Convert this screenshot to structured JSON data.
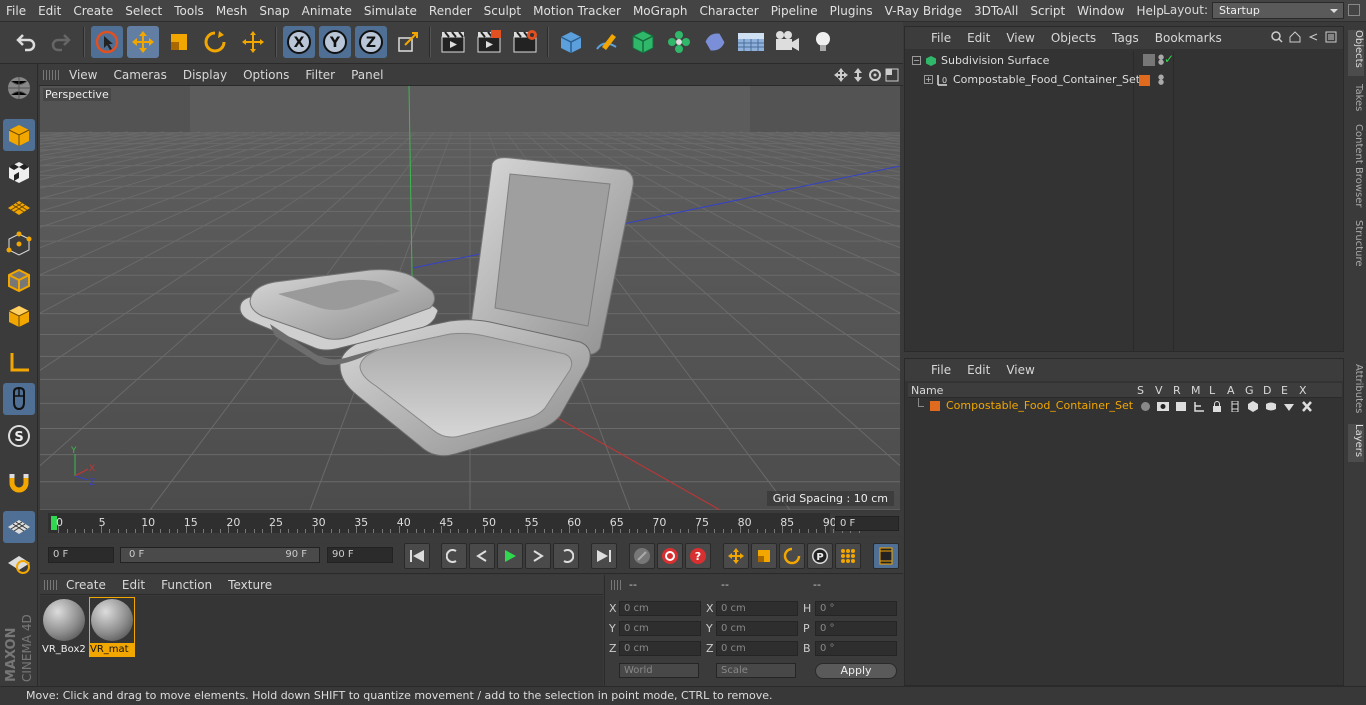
{
  "menu": [
    "File",
    "Edit",
    "Create",
    "Select",
    "Tools",
    "Mesh",
    "Snap",
    "Animate",
    "Simulate",
    "Render",
    "Sculpt",
    "Motion Tracker",
    "MoGraph",
    "Character",
    "Pipeline",
    "Plugins",
    "V-Ray Bridge",
    "3DToAll",
    "Script",
    "Window",
    "Help"
  ],
  "layout": {
    "label": "Layout:",
    "value": "Startup"
  },
  "viewport": {
    "menu": [
      "View",
      "Cameras",
      "Display",
      "Options",
      "Filter",
      "Panel"
    ],
    "camera": "Perspective",
    "grid_spacing": "Grid Spacing : 10 cm"
  },
  "axes": {
    "y": "Y",
    "x": "X",
    "z": "Z"
  },
  "timeline": {
    "ticks": [
      "0",
      "5",
      "10",
      "15",
      "20",
      "25",
      "30",
      "35",
      "40",
      "45",
      "50",
      "55",
      "60",
      "65",
      "70",
      "75",
      "80",
      "85",
      "90"
    ],
    "current": "0 F",
    "start": "0 F",
    "range_start": "0 F",
    "range_end": "90 F",
    "end": "90 F"
  },
  "materials": {
    "menu": [
      "Create",
      "Edit",
      "Function",
      "Texture"
    ],
    "items": [
      {
        "name": "VR_Box2"
      },
      {
        "name": "VR_mat"
      }
    ]
  },
  "coords": {
    "headers": [
      "--",
      "--",
      "--"
    ],
    "rows": [
      {
        "a": "X",
        "av": "0 cm",
        "b": "X",
        "bv": "0 cm",
        "c": "H",
        "cv": "0 °"
      },
      {
        "a": "Y",
        "av": "0 cm",
        "b": "Y",
        "bv": "0 cm",
        "c": "P",
        "cv": "0 °"
      },
      {
        "a": "Z",
        "av": "0 cm",
        "b": "Z",
        "bv": "0 cm",
        "c": "B",
        "cv": "0 °"
      }
    ],
    "world": "World",
    "scale": "Scale",
    "apply": "Apply"
  },
  "objects": {
    "menu": [
      "File",
      "Edit",
      "View",
      "Objects",
      "Tags",
      "Bookmarks"
    ],
    "items": [
      "Subdivision Surface",
      "Compostable_Food_Container_Set"
    ]
  },
  "layers": {
    "menu": [
      "File",
      "Edit",
      "View"
    ],
    "name_col": "Name",
    "cols": [
      "S",
      "V",
      "R",
      "M",
      "L",
      "A",
      "G",
      "D",
      "E",
      "X"
    ],
    "items": [
      "Compostable_Food_Container_Set"
    ],
    "color": "#e06a1e"
  },
  "side_tabs": [
    "Objects",
    "Takes",
    "Content Browser",
    "Structure",
    "Attributes",
    "Layers"
  ],
  "status": "Move: Click and drag to move elements. Hold down SHIFT to quantize movement / add to the selection in point mode, CTRL to remove.",
  "brand": "MAXON CINEMA 4D"
}
